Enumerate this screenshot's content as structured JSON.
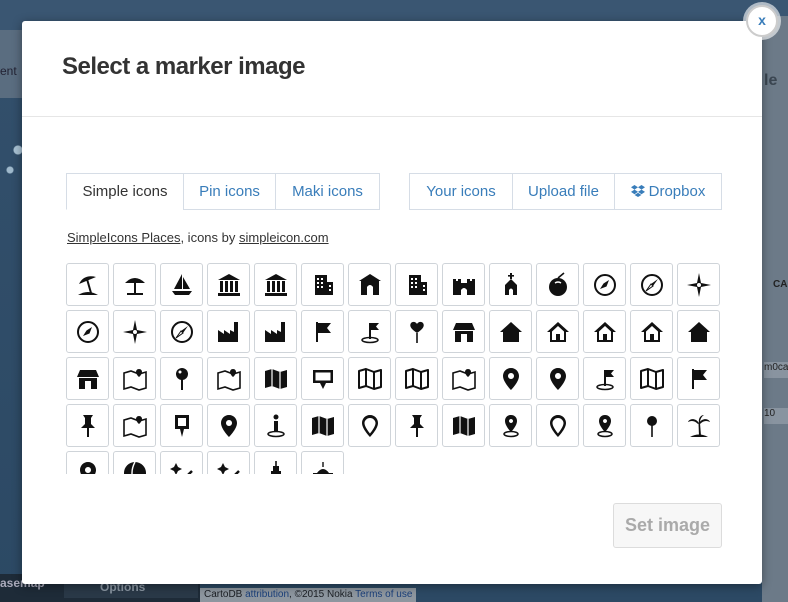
{
  "background": {
    "left_label": "ent",
    "right_label": "le",
    "right_ca": "CA",
    "right_field_1": "m0ca",
    "right_field_2": "10",
    "basemap_label": "asemap",
    "options_label": "Options",
    "attribution_prefix": "CartoDB ",
    "attribution_link": "attribution",
    "attribution_middle": ", ©2015 Nokia ",
    "attribution_terms": "Terms of use"
  },
  "modal": {
    "title": "Select a marker image",
    "close_label": "x",
    "tabs": [
      {
        "label": "Simple icons",
        "active": true
      },
      {
        "label": "Pin icons",
        "active": false
      },
      {
        "label": "Maki icons",
        "active": false
      },
      {
        "label": "Your icons",
        "active": false
      },
      {
        "label": "Upload file",
        "active": false
      },
      {
        "label": "Dropbox",
        "active": false
      }
    ],
    "source_link": "SimpleIcons Places",
    "source_middle": ", icons by ",
    "source_site": "simpleicon.com",
    "set_image_label": "Set image"
  },
  "icons": [
    "beach-umbrella-icon",
    "umbrella-table-icon",
    "sailboat-icon",
    "museum-icon",
    "government-building-icon",
    "office-building-icon",
    "temple-icon",
    "skyscraper-icon",
    "castle-icon",
    "church-icon",
    "coconut-drink-icon",
    "compass-icon",
    "compass-needle-icon",
    "compass-rose-icon",
    "compass-circle-icon",
    "wind-rose-icon",
    "compass-small-icon",
    "factory-icon",
    "factory-alt-icon",
    "flag-icon",
    "flag-pin-icon",
    "heart-pin-icon",
    "house-icon",
    "home-solid-icon",
    "home-outline-icon",
    "home-door-icon",
    "home-tall-icon",
    "home-circle-icon",
    "store-icon",
    "map-route-icon",
    "pushpin-round-icon",
    "map-flag-icon",
    "folded-map-icon",
    "speech-pin-icon",
    "map-outline-icon",
    "map-open-icon",
    "map-pin-folded-icon",
    "location-pin-icon",
    "location-pin-dot-icon",
    "flag-location-icon",
    "city-map-icon",
    "signpost-icon",
    "thumbtack-icon",
    "map-pin-area-icon",
    "square-pin-icon",
    "location-pin-hole-icon",
    "person-location-icon",
    "folded-map-dark-icon",
    "location-pin-outline-icon",
    "push-pin-icon",
    "map-dark-icon",
    "map-marker-base-icon",
    "location-pin-ring-icon",
    "location-pin-base-icon",
    "pin-needle-icon",
    "palm-tree-icon",
    "location-pin-small-icon",
    "beach-ball-icon",
    "sun-wand-icon",
    "sparkle-wand-icon",
    "tower-icon",
    "mosque-icon"
  ]
}
